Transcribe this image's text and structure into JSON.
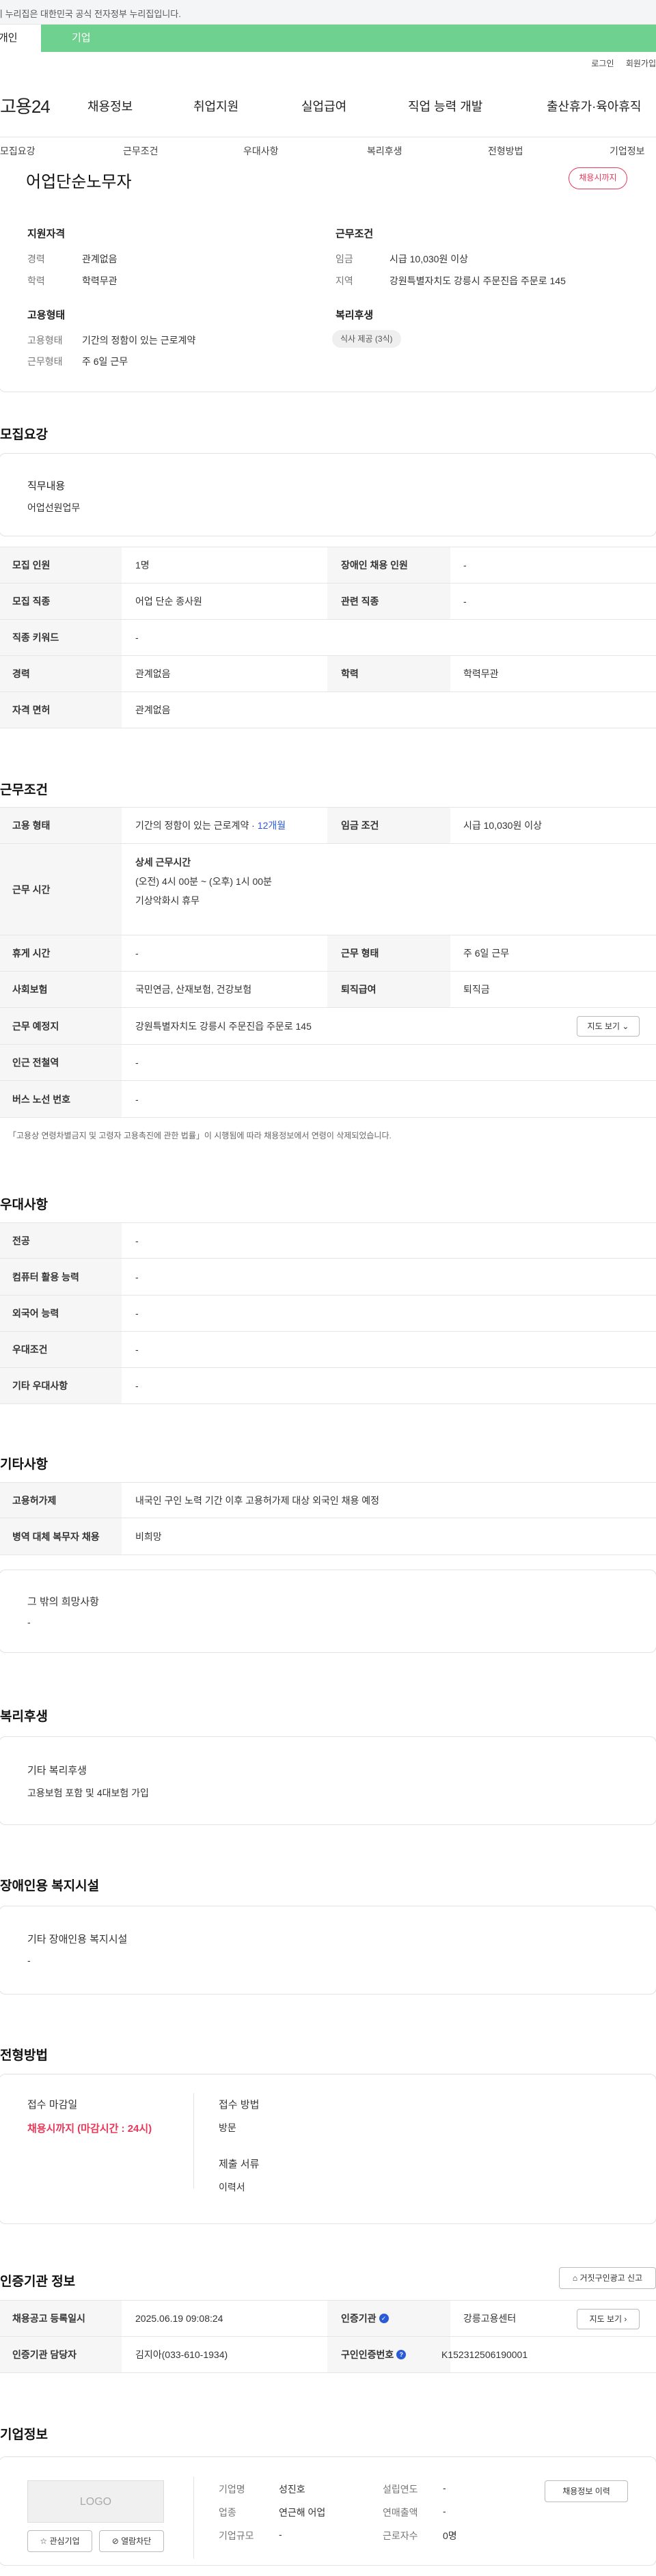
{
  "gov_banner": "이 누리집은 대한민국 공식 전자정부 누리집입니다.",
  "user_tabs": [
    "개인",
    "기업"
  ],
  "top_links": [
    "로그인",
    "회원가입"
  ],
  "logo": "고용24",
  "gnb": [
    "채용정보",
    "취업지원",
    "실업급여",
    "직업 능력 개발",
    "출산휴가·육아휴직"
  ],
  "lnb": [
    "모집요강",
    "근무조건",
    "우대사항",
    "복리후생",
    "전형방법",
    "기업정보"
  ],
  "header_card": {
    "title": "어업단순노무자",
    "deadline_badge": "채용시까지",
    "qualification_label": "지원자격",
    "experience_k": "경력",
    "experience_v": "관계없음",
    "education_k": "학력",
    "education_v": "학력무관",
    "employment_label": "고용형태",
    "emp_type_k": "고용형태",
    "emp_type_v": "기간의 정함이 있는 근로계약",
    "work_form_k": "근무형태",
    "work_form_v": "주 6일 근무",
    "condition_label": "근무조건",
    "wage_k": "임금",
    "wage_v": "시급 10,030원 이상",
    "region_k": "지역",
    "region_v": "강원특별자치도 강릉시 주문진읍 주문로 145",
    "welfare_label": "복리후생",
    "welfare_pill": "식사 제공 (3식)"
  },
  "recruit": {
    "title": "모집요강",
    "duty_label": "직무내용",
    "duty_value": "어업선원업무",
    "rows": [
      [
        "모집 인원",
        "1명",
        "장애인 채용 인원",
        "-"
      ],
      [
        "모집 직종",
        "어업 단순 종사원",
        "관련 직종",
        "-"
      ],
      [
        "직종 키워드",
        "-"
      ],
      [
        "경력",
        "관계없음",
        "학력",
        "학력무관"
      ],
      [
        "자격 면허",
        "관계없음"
      ]
    ]
  },
  "work": {
    "title": "근무조건",
    "emp_k": "고용 형태",
    "emp_v": "기간의 정함이 있는 근로계약 · ",
    "emp_v_blue": "12개월",
    "wage_k": "임금 조건",
    "wage_v": "시급 10,030원 이상",
    "time_k": "근무 시간",
    "time_label": "상세 근무시간",
    "time_v1": "(오전) 4시 00분 ~ (오후) 1시 00분",
    "time_v2": "기상악화시 휴무",
    "rest_k": "휴게 시간",
    "rest_v": "-",
    "form_k": "근무 형태",
    "form_v": "주 6일 근무",
    "ins_k": "사회보험",
    "ins_v": "국민연금, 산재보험, 건강보험",
    "ret_k": "퇴직급여",
    "ret_v": "퇴직금",
    "place_k": "근무 예정지",
    "place_v": "강원특별자치도 강릉시 주문진읍 주문로 145",
    "map_btn": "지도 보기",
    "sub_k": "인근 전철역",
    "sub_v": "-",
    "bus_k": "버스 노선 번호",
    "bus_v": "-",
    "note": "「고용상 연령차별금지 및 고령자 고용촉진에 관한 법률」이 시행됨에 따라 채용정보에서 연령이 삭제되었습니다."
  },
  "prefer": {
    "title": "우대사항",
    "rows": [
      [
        "전공",
        "-"
      ],
      [
        "컴퓨터 활용 능력",
        "-"
      ],
      [
        "외국어 능력",
        "-"
      ],
      [
        "우대조건",
        "-"
      ],
      [
        "기타 우대사항",
        "-"
      ]
    ]
  },
  "etc": {
    "title": "기타사항",
    "rows": [
      [
        "고용허가제",
        "내국인 구인 노력 기간 이후 고용허가제 대상 외국인 채용 예정"
      ],
      [
        "병역 대체 복무자 채용",
        "비희망"
      ]
    ],
    "other_label": "그 밖의 희망사항",
    "other_value": "-"
  },
  "welfare": {
    "title": "복리후생",
    "label": "기타 복리후생",
    "value": "고용보험 포함 및 4대보험 가입"
  },
  "disabled": {
    "title": "장애인용 복지시설",
    "label": "기타 장애인용 복지시설",
    "value": "-"
  },
  "selection": {
    "title": "전형방법",
    "deadline_label": "접수 마감일",
    "deadline_value": "채용시까지 (마감시간 : 24시)",
    "method_label": "접수 방법",
    "method_value": "방문",
    "docs_label": "제출 서류",
    "docs_value": "이력서"
  },
  "agency": {
    "title": "인증기관 정보",
    "report_btn": "거짓구인광고 신고",
    "reg_k": "채용공고 등록일시",
    "reg_v": "2025.06.19 09:08:24",
    "org_k": "인증기관",
    "org_v": "강릉고용센터",
    "map_btn": "지도 보기",
    "mgr_k": "인증기관 담당자",
    "mgr_v": "김지아(033-610-1934)",
    "num_k": "구인인증번호",
    "num_v": "K152312506190001"
  },
  "company": {
    "title": "기업정보",
    "logo": "LOGO",
    "fav_btn": "관심기업",
    "block_btn": "열람차단",
    "name_k": "기업명",
    "name_v": "성진호",
    "industry_k": "업종",
    "industry_v": "연근해 어업",
    "size_k": "기업규모",
    "size_v": "-",
    "year_k": "설립연도",
    "year_v": "-",
    "sales_k": "연매출액",
    "sales_v": "-",
    "emp_k": "근로자수",
    "emp_v": "0명",
    "history_btn": "채용정보 이력"
  }
}
